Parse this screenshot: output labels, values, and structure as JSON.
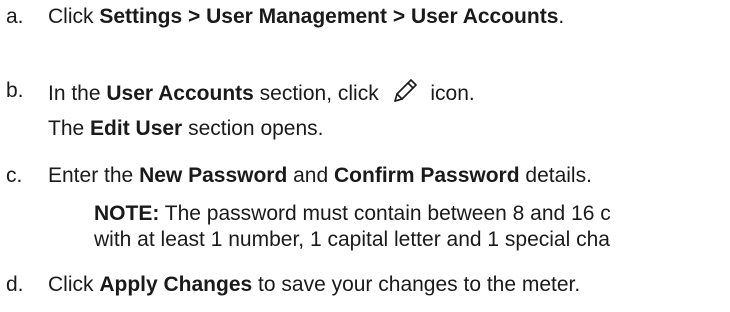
{
  "steps": [
    {
      "marker": "a.",
      "prefix": "Click ",
      "bold": "Settings > User Management > User Accounts",
      "suffix": "."
    },
    {
      "marker": "b.",
      "prefix": "In the ",
      "bold": "User Accounts",
      "middle": " section, click ",
      "icon": "pencil-icon",
      "suffix": " icon.",
      "result_prefix": "The ",
      "result_bold": "Edit User",
      "result_suffix": " section opens."
    },
    {
      "marker": "c.",
      "prefix": "Enter the ",
      "bold1": "New Password",
      "middle": " and ",
      "bold2": "Confirm Password",
      "suffix": " details.",
      "note_label": "NOTE:",
      "note_line1": " The password must contain between 8 and 16 c",
      "note_line2": "with at least 1 number, 1 capital letter and 1 special cha"
    },
    {
      "marker": "d.",
      "prefix": "Click ",
      "bold": "Apply Changes",
      "suffix": " to save your changes to the meter."
    }
  ]
}
